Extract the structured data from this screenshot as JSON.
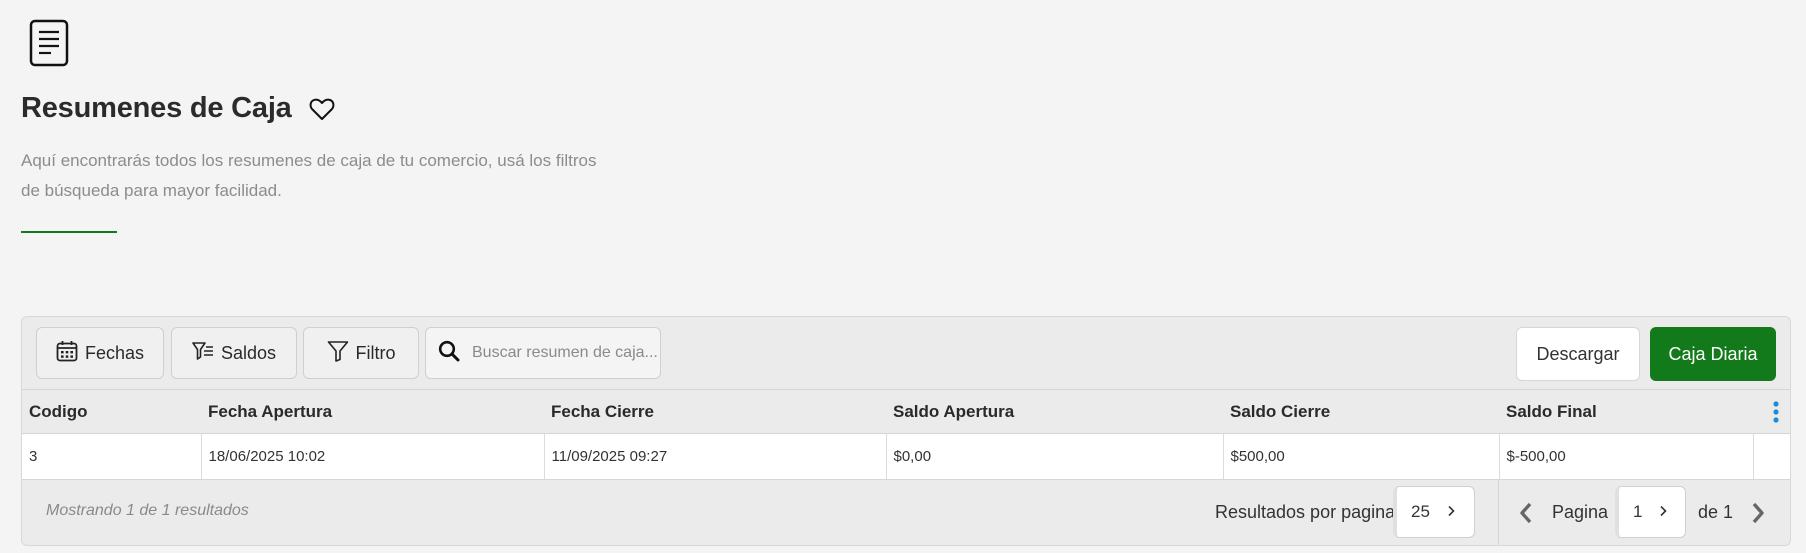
{
  "header": {
    "icon": "document-icon",
    "title": "Resumenes de Caja",
    "favorite_icon": "heart-icon",
    "description_line1": "Aquí encontrarás todos los resumenes de caja de tu comercio, usá los filtros",
    "description_line2": "de búsqueda para mayor facilidad.",
    "underline_color": "#137a1b"
  },
  "toolbar": {
    "fechas_label": "Fechas",
    "saldos_label": "Saldos",
    "filtro_label": "Filtro",
    "search_placeholder": "Buscar resumen de caja...",
    "download_label": "Descargar",
    "caja_diaria_label": "Caja Diaria",
    "accent_color": "#137a1b"
  },
  "table": {
    "columns": [
      "Codigo",
      "Fecha Apertura",
      "Fecha Cierre",
      "Saldo Apertura",
      "Saldo Cierre",
      "Saldo Final"
    ],
    "rows": [
      [
        "3",
        "18/06/2025 10:02",
        "11/09/2025 09:27",
        "$0,00",
        "$500,00",
        "$-500,00"
      ]
    ],
    "menu_icon": "kebab-menu-icon",
    "menu_icon_color": "#1a8fd6"
  },
  "footer": {
    "showing": "Mostrando 1 de 1 resultados",
    "per_page_label": "Resultados por pagina",
    "per_page_value": "25",
    "page_label": "Pagina",
    "page_value": "1",
    "of_label": "de 1"
  }
}
